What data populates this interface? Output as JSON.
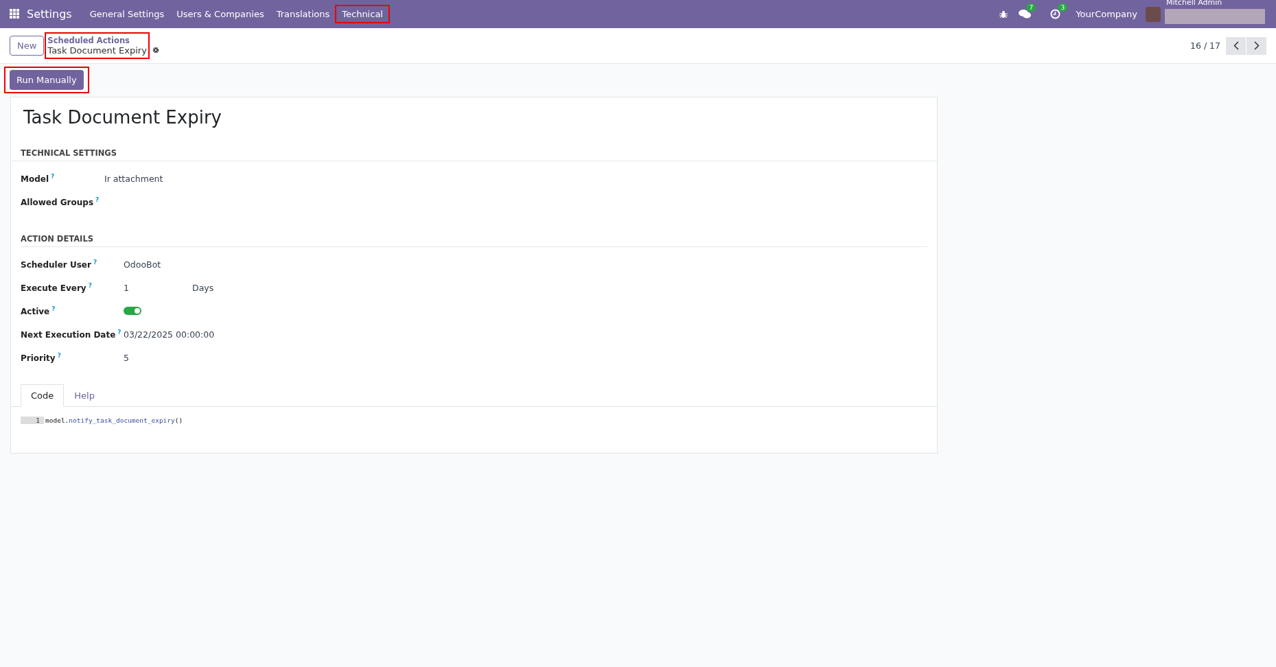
{
  "navbar": {
    "app_name": "Settings",
    "menu": [
      {
        "label": "General Settings",
        "highlighted": false
      },
      {
        "label": "Users & Companies",
        "highlighted": false
      },
      {
        "label": "Translations",
        "highlighted": false
      },
      {
        "label": "Technical",
        "highlighted": true
      }
    ],
    "messages_count": "7",
    "activities_count": "3",
    "company": "YourCompany",
    "user_name": "Mitchell Admin"
  },
  "control_panel": {
    "new_button": "New",
    "breadcrumb_parent": "Scheduled Actions",
    "breadcrumb_current": "Task Document Expiry",
    "breadcrumb_highlighted": true,
    "pager": "16 / 17"
  },
  "action_button": {
    "label": "Run Manually",
    "highlighted": true
  },
  "form": {
    "title": "Task Document Expiry",
    "sections": [
      {
        "title": "TECHNICAL SETTINGS",
        "fields": [
          {
            "label": "Model",
            "kind": "text",
            "value": "Ir attachment"
          },
          {
            "label": "Allowed Groups",
            "kind": "empty"
          }
        ]
      },
      {
        "title": "ACTION DETAILS",
        "fields": [
          {
            "label": "Scheduler User",
            "kind": "text",
            "value": "OdooBot"
          },
          {
            "label": "Execute Every",
            "kind": "interval",
            "value": "1",
            "unit": "Days"
          },
          {
            "label": "Active",
            "kind": "toggle",
            "on": true
          },
          {
            "label": "Next Execution Date",
            "kind": "text",
            "value": "03/22/2025 00:00:00"
          },
          {
            "label": "Priority",
            "kind": "text",
            "value": "5"
          }
        ]
      }
    ],
    "help_mark": "?",
    "tabs": [
      {
        "label": "Code",
        "selected": true
      },
      {
        "label": "Help",
        "selected": false
      }
    ],
    "code_lines": [
      {
        "number": "1",
        "tokens": [
          {
            "text": "model.",
            "kind": "plain"
          },
          {
            "text": "notify_task_document_expiry",
            "kind": "method"
          },
          {
            "text": "()",
            "kind": "plain"
          }
        ]
      }
    ]
  }
}
